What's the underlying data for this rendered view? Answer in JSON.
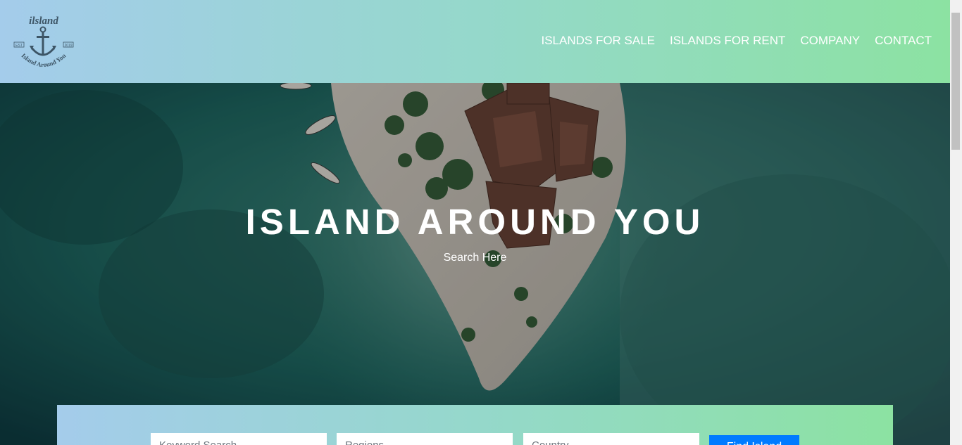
{
  "logo": {
    "brand": "ilsland",
    "tagline": "Island Around You",
    "left_year": "EST",
    "right_year": "2019"
  },
  "nav": {
    "items": [
      {
        "label": "ISLANDS FOR SALE"
      },
      {
        "label": "ISLANDS FOR RENT"
      },
      {
        "label": "COMPANY"
      },
      {
        "label": "CONTACT"
      }
    ]
  },
  "hero": {
    "title": "ISLAND AROUND YOU",
    "subtitle": "Search Here"
  },
  "search": {
    "keyword_placeholder": "Keyword Search",
    "regions_placeholder": "Regions",
    "country_placeholder": "Country",
    "button_label": "Find Island"
  },
  "colors": {
    "gradient_start": "#a4cceb",
    "gradient_end": "#8ce2a2",
    "button": "#007bff"
  }
}
